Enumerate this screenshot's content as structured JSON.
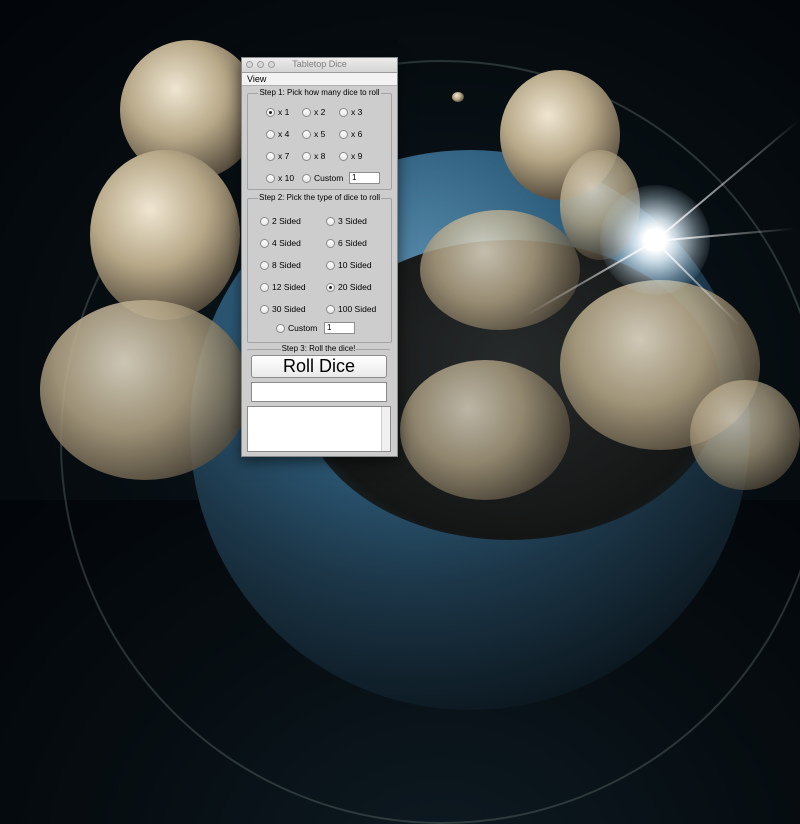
{
  "window": {
    "title": "Tabletop Dice",
    "menu": [
      "View"
    ]
  },
  "step1": {
    "title": "Step 1: Pick how many dice to roll",
    "options": [
      "x 1",
      "x 2",
      "x 3",
      "x 4",
      "x 5",
      "x 6",
      "x 7",
      "x 8",
      "x 9",
      "x 10",
      "Custom"
    ],
    "selected": "x 1",
    "custom_value": "1"
  },
  "step2": {
    "title": "Step 2: Pick the type of dice to roll",
    "options": [
      "2 Sided",
      "3 Sided",
      "4 Sided",
      "6 Sided",
      "8 Sided",
      "10 Sided",
      "12 Sided",
      "20 Sided",
      "30 Sided",
      "100 Sided",
      "Custom"
    ],
    "selected": "20 Sided",
    "custom_value": "1"
  },
  "step3": {
    "title": "Step 3: Roll the dice!",
    "roll_label": "Roll Dice",
    "result": ""
  },
  "colors": {
    "window_bg": "#cdcdcd",
    "field_bg": "#ffffff"
  }
}
